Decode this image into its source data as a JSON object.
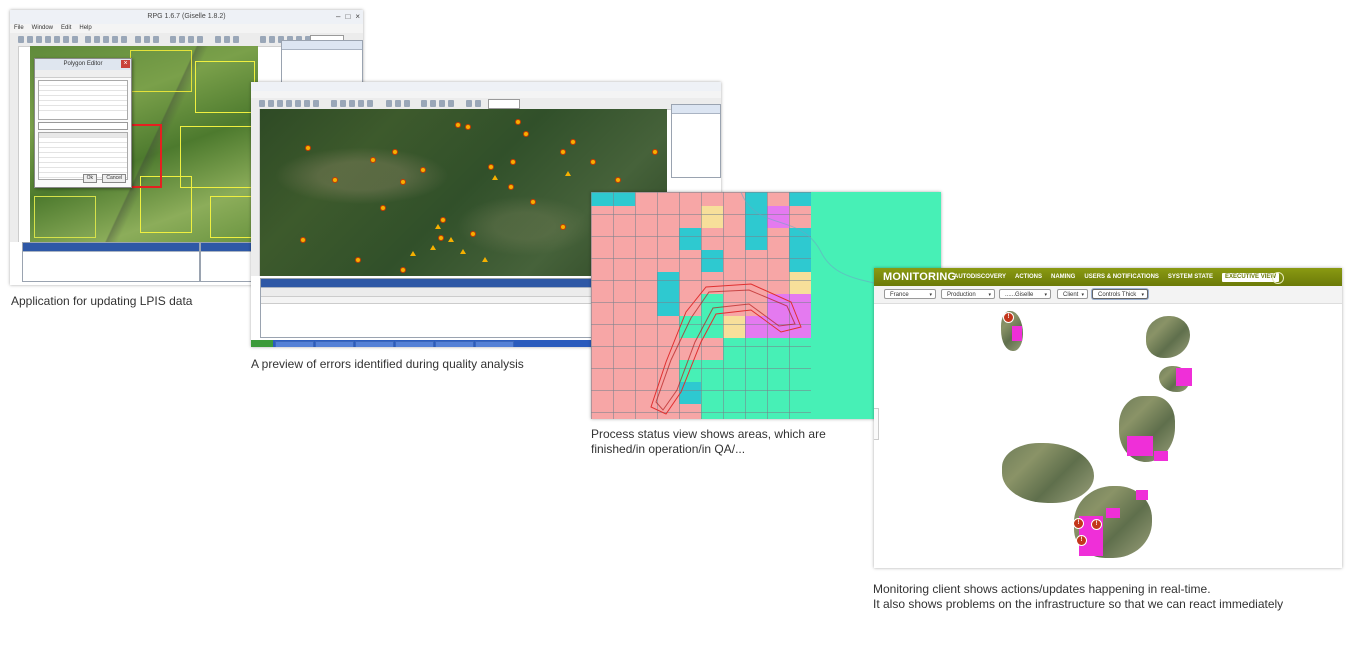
{
  "captions": {
    "shot1": "Application for updating LPIS data",
    "shot2": "A preview of errors identified during quality analysis",
    "shot3": "Process status view shows areas, which are finished/in operation/in QA/...",
    "shot4_line1": "Monitoring client shows actions/updates happening in real-time.",
    "shot4_line2": "It also shows problems on the infrastructure so that we can react immediately"
  },
  "shot1": {
    "window_title": "RPG 1.6.7 (Giselle 1.8.2)",
    "menu": [
      "File",
      "Window",
      "Edit",
      "Help"
    ],
    "polygon_editor": {
      "title": "Polygon Editor",
      "ok_label": "Ok",
      "cancel_label": "Cancel"
    }
  },
  "monitoring": {
    "logo": "MONITORING",
    "nav": [
      "AUTODISCOVERY",
      "ACTIONS",
      "NAMING",
      "USERS & NOTIFICATIONS",
      "SYSTEM STATE"
    ],
    "nav_active": "EXECUTIVE VIEW",
    "filters": [
      "France",
      "Production",
      "......Giselle",
      "Client",
      "Controls Thick"
    ],
    "alert_symbol": "!",
    "colors": {
      "header": "#7a8a0e",
      "highlight": "#ef2fd8",
      "alert": "#c3361b"
    }
  },
  "status_colors": {
    "finished": "#47f0b6",
    "in_operation": "#f7a6a6",
    "in_qa": "#2ec9d0",
    "pending": "#f7df9a",
    "error": "#e47af0"
  }
}
